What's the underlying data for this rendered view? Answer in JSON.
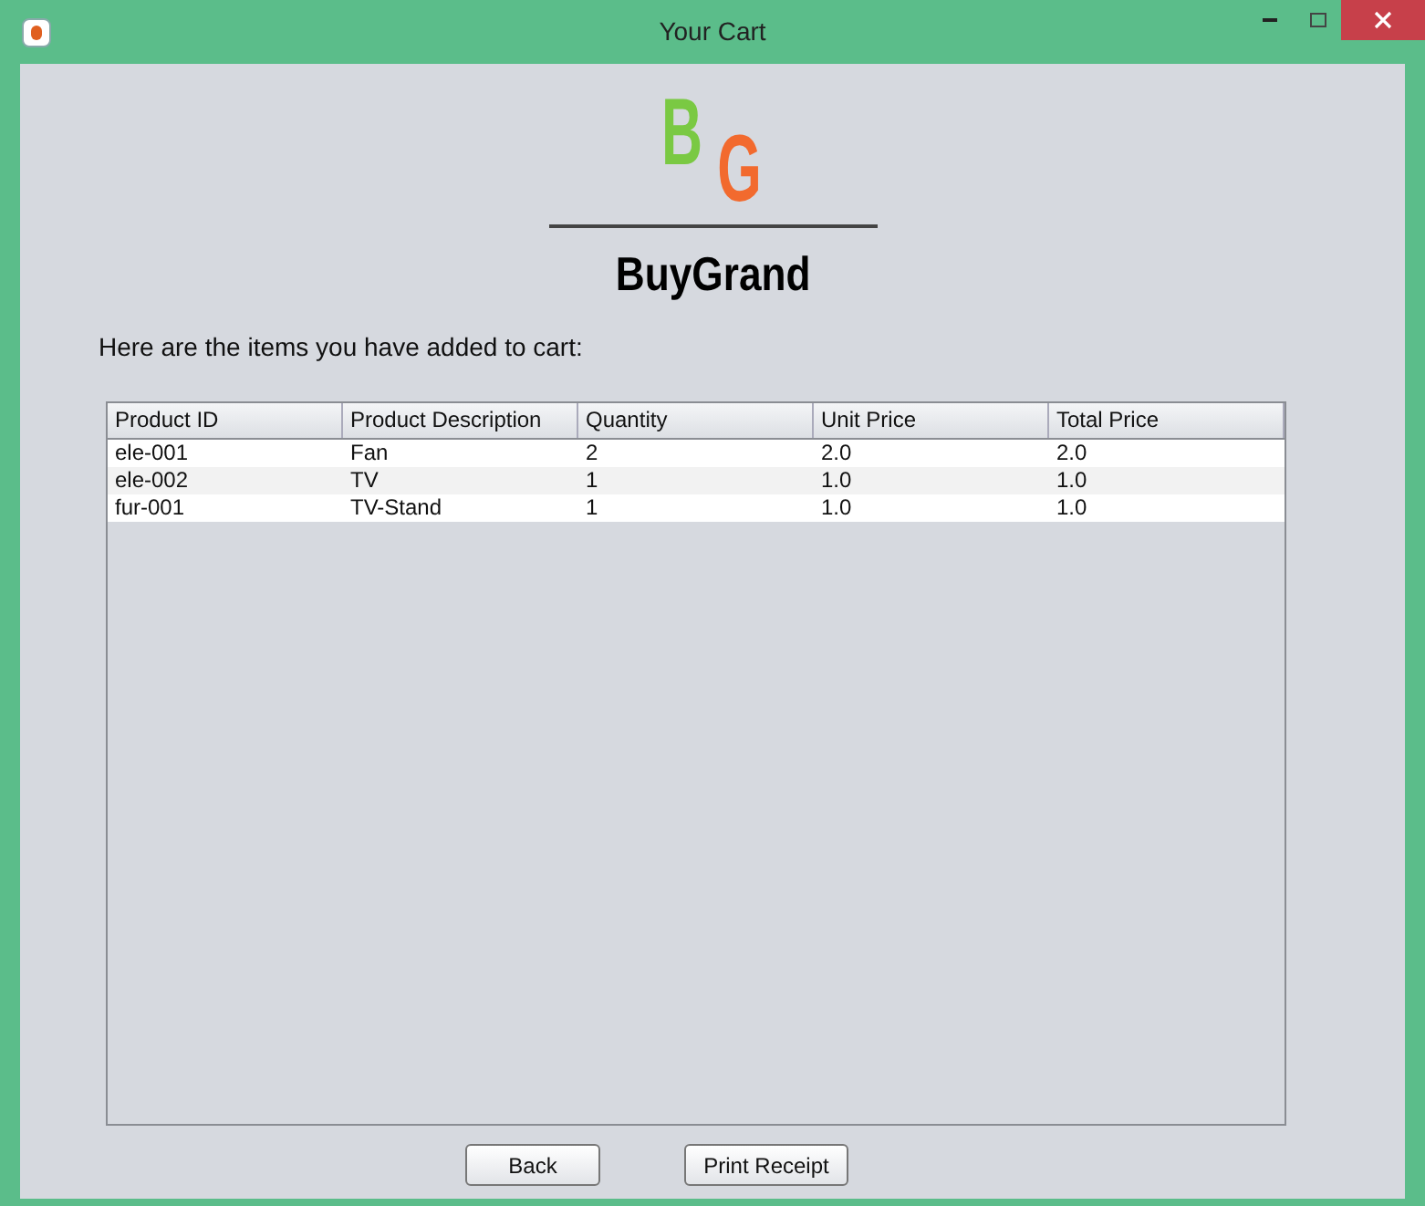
{
  "window": {
    "title": "Your Cart"
  },
  "logo": {
    "letters": [
      "B",
      "G"
    ],
    "name": "BuyGrand"
  },
  "intro": "Here are the items you have added to cart:",
  "table": {
    "columns": [
      "Product ID",
      "Product Description",
      "Quantity",
      "Unit Price",
      "Total Price"
    ],
    "rows": [
      [
        "ele-001",
        "Fan",
        "2",
        "2.0",
        "2.0"
      ],
      [
        "ele-002",
        "TV",
        "1",
        "1.0",
        "1.0"
      ],
      [
        "fur-001",
        "TV-Stand",
        "1",
        "1.0",
        "1.0"
      ]
    ]
  },
  "buttons": [
    "Back",
    "Print Receipt"
  ]
}
